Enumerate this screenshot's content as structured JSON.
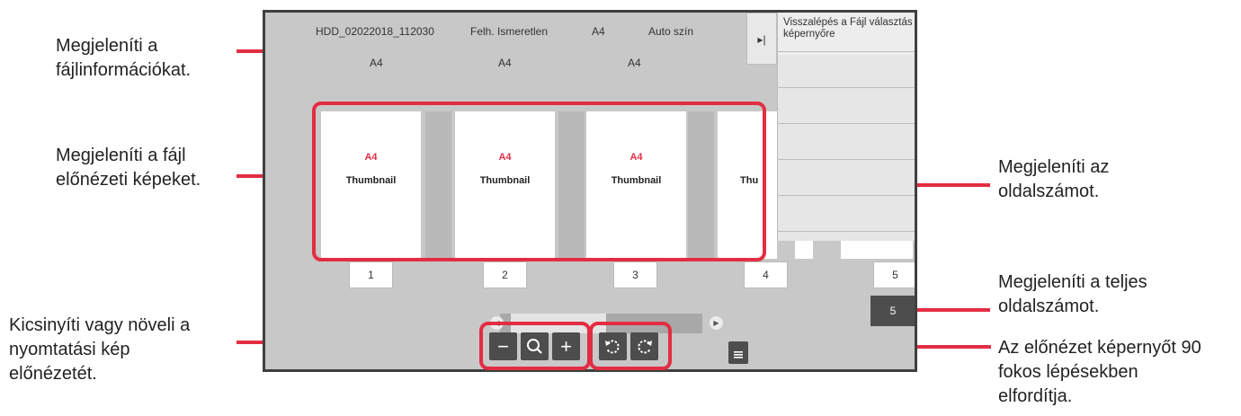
{
  "callouts": {
    "file_info": "Megjeleníti a\nfájlinformációkat.",
    "preview_images": "Megjeleníti a fájl\nelőnézeti képeket.",
    "zoom": "Kicsinyíti vagy növeli a\nnyomtatási kép\nelőnézetét.",
    "page_number": "Megjeleníti az\noldalszámot.",
    "total_pages": "Megjeleníti a teljes\noldalszámot.",
    "rotate": "Az előnézet képernyőt 90\nfokos lépésekben\nelfordítja."
  },
  "file_info": {
    "name": "HDD_02022018_112030",
    "user": "Felh. Ismeretlen",
    "paper": "A4",
    "color_mode": "Auto szín",
    "sizes": [
      "A4",
      "A4",
      "A4"
    ]
  },
  "side_panel": {
    "back_label": "Visszalépés a Fájl választás képernyőre",
    "collapse_icon": "collapse-arrow-icon"
  },
  "thumbnails": [
    {
      "size": "A4",
      "label": "Thumbnail"
    },
    {
      "size": "A4",
      "label": "Thumbnail"
    },
    {
      "size": "A4",
      "label": "Thumbnail"
    },
    {
      "size": "A4",
      "label": "Thu"
    }
  ],
  "page_numbers": [
    "1",
    "2",
    "3",
    "4",
    "5"
  ],
  "total_pages": "5",
  "controls": {
    "zoom_out_icon": "minus-icon",
    "zoom_icon": "magnifier-icon",
    "zoom_in_icon": "plus-icon",
    "rotate_left_icon": "rotate-left-icon",
    "rotate_right_icon": "rotate-right-icon"
  },
  "colors": {
    "accent": "#e32d43",
    "screen_bg": "#c8c8c8",
    "control_bg": "#4d4d4d"
  }
}
